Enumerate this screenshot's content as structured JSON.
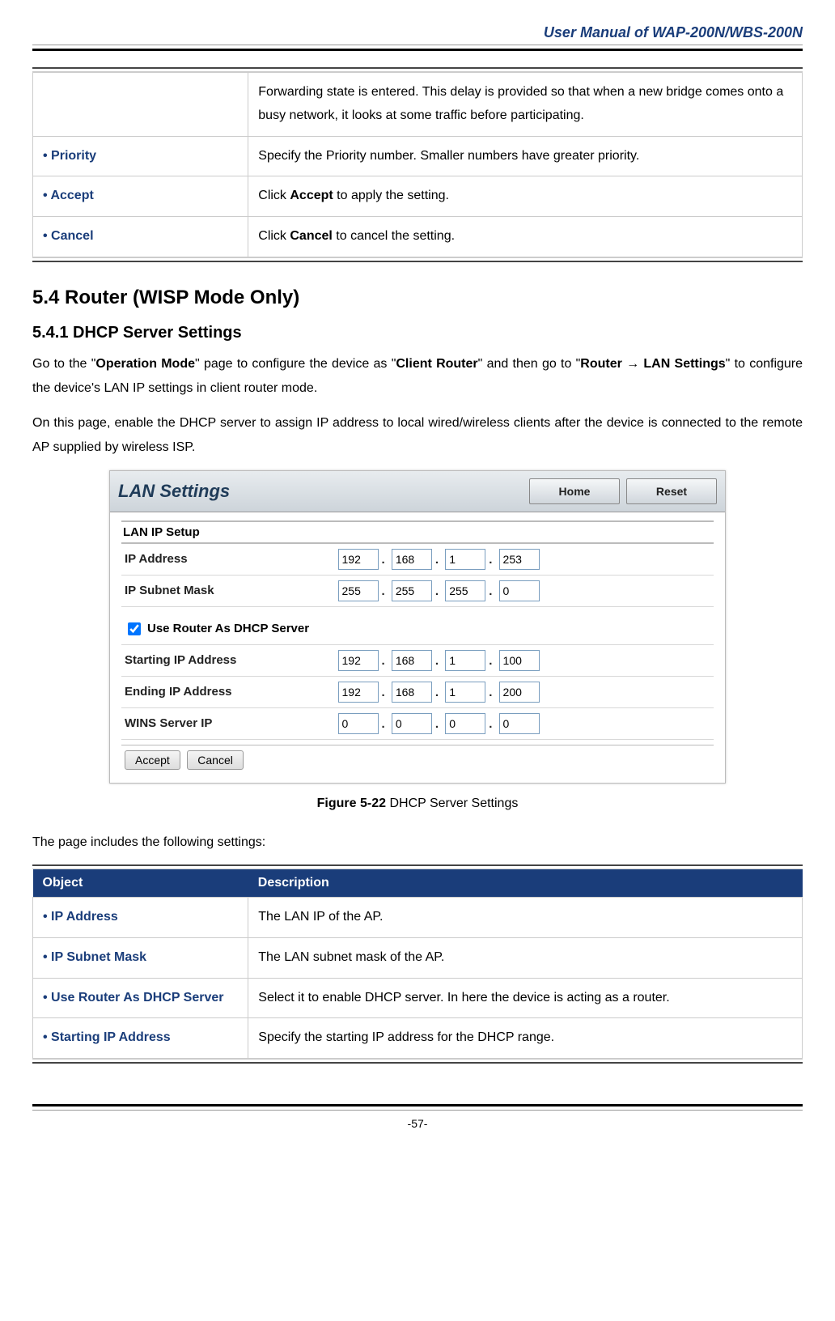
{
  "header": {
    "title": "User Manual of WAP-200N/WBS-200N"
  },
  "table1": {
    "rows": [
      {
        "obj": "",
        "desc_prefix": "Forwarding state is entered. This delay is provided so that when a new bridge comes onto a busy network, it looks at some traffic before participating."
      },
      {
        "obj": "Priority",
        "desc": "Specify the Priority number. Smaller numbers have greater priority."
      },
      {
        "obj": "Accept",
        "desc_pre": "Click ",
        "desc_bold": "Accept",
        "desc_post": " to apply the setting."
      },
      {
        "obj": "Cancel",
        "desc_pre": "Click ",
        "desc_bold": "Cancel",
        "desc_post": " to cancel the setting."
      }
    ]
  },
  "section": {
    "h2": "5.4  Router (WISP Mode Only)",
    "h3": "5.4.1  DHCP Server Settings",
    "p1_parts": {
      "t1": "Go to the \"",
      "b1": "Operation Mode",
      "t2": "\" page to configure the device as \"",
      "b2": "Client Router",
      "t3": "\" and then go to \"",
      "b3": "Router ",
      "b4": " LAN Settings",
      "t4": "\" to configure the device's LAN IP settings in client router mode."
    },
    "p2": "On this page, enable the DHCP server to assign IP address to local wired/wireless clients after the device is connected to the remote AP supplied by wireless ISP."
  },
  "lan_panel": {
    "title": "LAN Settings",
    "home_btn": "Home",
    "reset_btn": "Reset",
    "section_label": "LAN IP Setup",
    "ip_address_label": "IP Address",
    "ip_address": [
      "192",
      "168",
      "1",
      "253"
    ],
    "subnet_label": "IP Subnet Mask",
    "subnet": [
      "255",
      "255",
      "255",
      "0"
    ],
    "dhcp_checkbox_label": "Use Router As DHCP Server",
    "starting_label": "Starting IP Address",
    "starting": [
      "192",
      "168",
      "1",
      "100"
    ],
    "ending_label": "Ending IP Address",
    "ending": [
      "192",
      "168",
      "1",
      "200"
    ],
    "wins_label": "WINS Server IP",
    "wins": [
      "0",
      "0",
      "0",
      "0"
    ],
    "accept_btn": "Accept",
    "cancel_btn": "Cancel"
  },
  "figure": {
    "num": "Figure 5-22",
    "caption": " DHCP Server Settings"
  },
  "table2_intro": "The page includes the following settings:",
  "table2": {
    "head_obj": "Object",
    "head_desc": "Description",
    "rows": [
      {
        "obj": "IP Address",
        "desc": "The LAN IP of the AP."
      },
      {
        "obj": "IP Subnet Mask",
        "desc": "The LAN subnet mask of the AP."
      },
      {
        "obj": "Use Router As DHCP Server",
        "desc": "Select it to enable DHCP server. In here the device is acting as a router."
      },
      {
        "obj": "Starting IP Address",
        "desc": "Specify the starting IP address for the DHCP range."
      }
    ]
  },
  "footer": {
    "page": "-57-"
  }
}
